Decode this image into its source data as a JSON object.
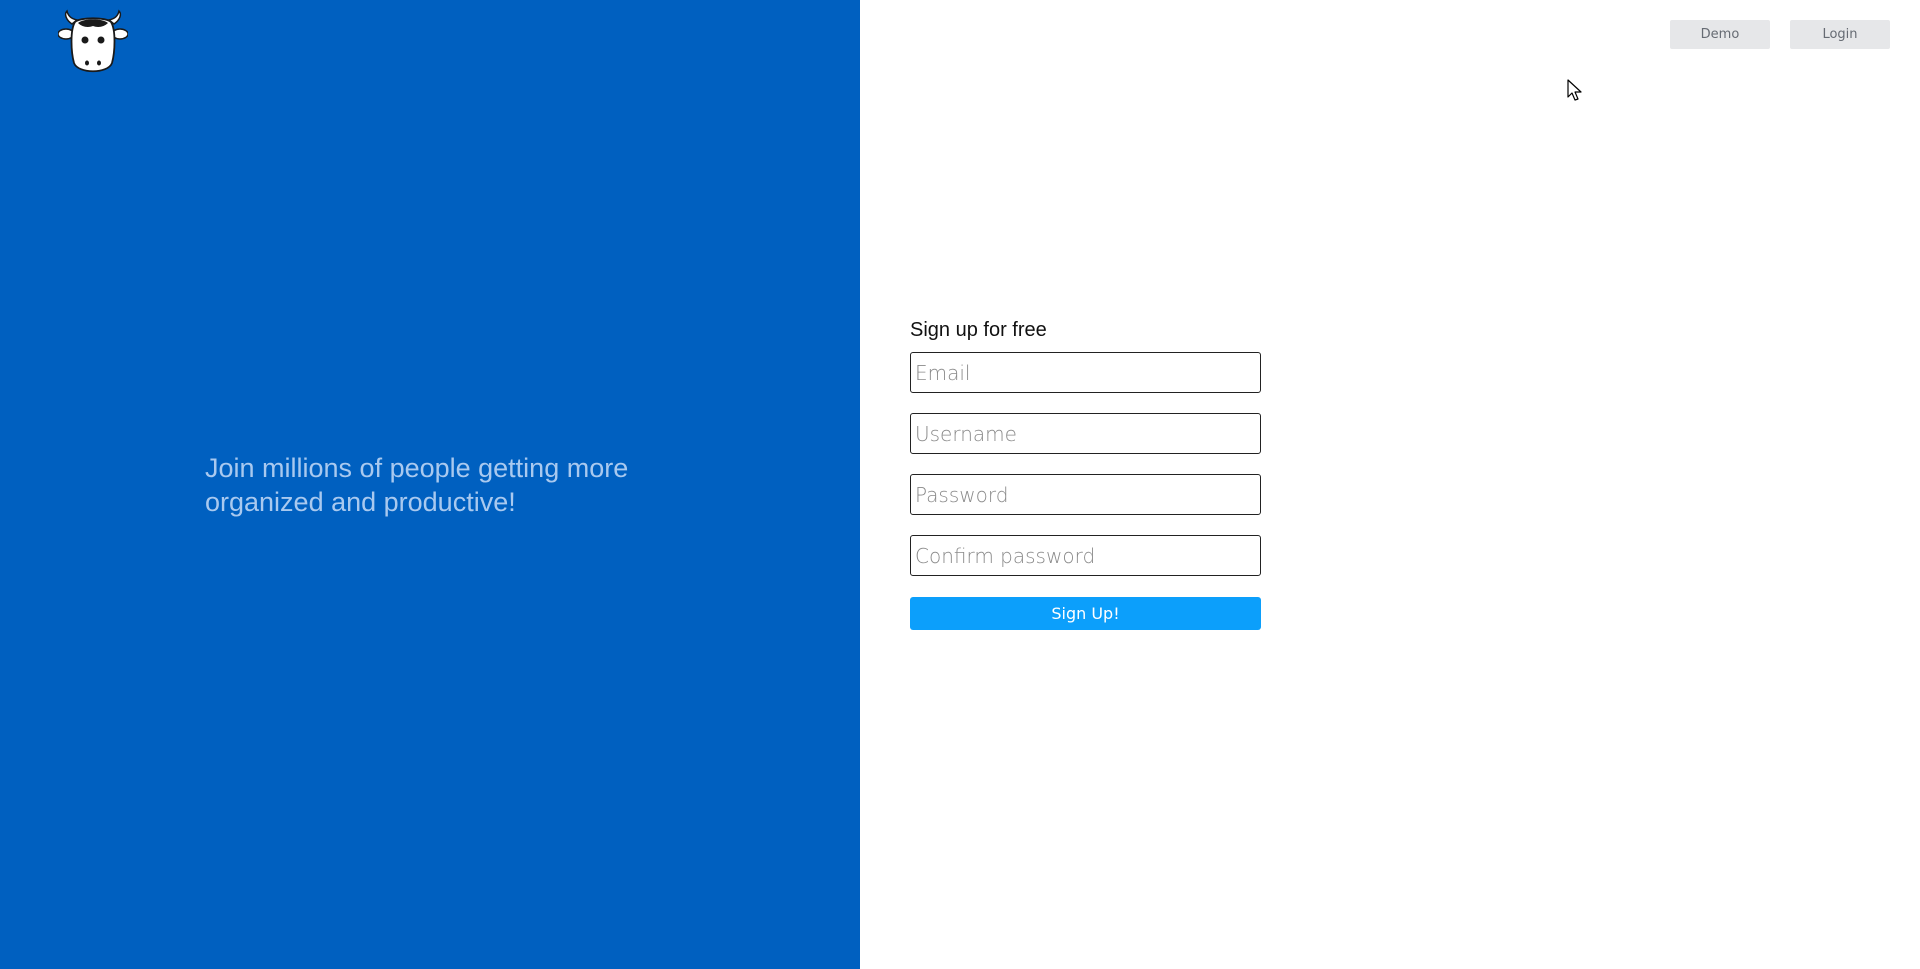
{
  "header": {
    "demo_label": "Demo",
    "login_label": "Login"
  },
  "hero": {
    "tagline": "Join millions of people getting more organized and productive!",
    "background_color": "#0060c0",
    "logo_icon": "cow-logo-icon"
  },
  "signup": {
    "title": "Sign up for free",
    "email_placeholder": "Email",
    "email_value": "",
    "username_placeholder": "Username",
    "username_value": "",
    "password_placeholder": "Password",
    "password_value": "",
    "confirm_password_placeholder": "Confirm password",
    "confirm_password_value": "",
    "submit_label": "Sign Up!",
    "submit_color": "#0c9ffb"
  }
}
